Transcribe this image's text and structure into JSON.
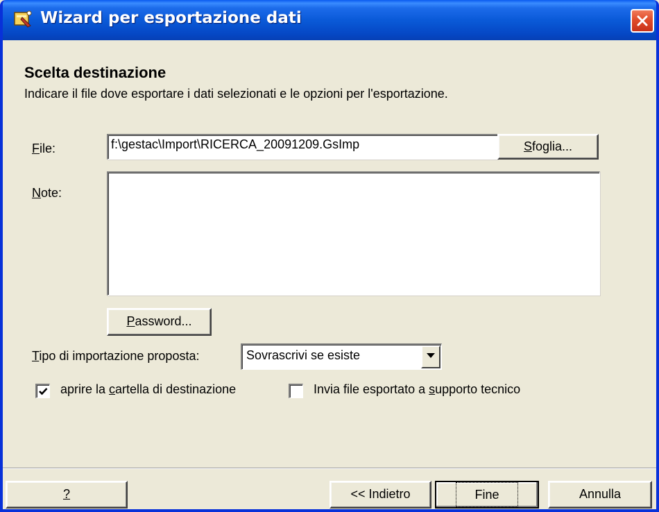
{
  "window": {
    "title": "Wizard per esportazione dati",
    "icon": "wizard-app-icon",
    "close_icon": "close-icon"
  },
  "page": {
    "heading": "Scelta destinazione",
    "description": "Indicare il file dove esportare i dati selezionati e le opzioni per l'esportazione."
  },
  "file": {
    "label_mnemonic": "F",
    "label_rest": "ile:",
    "value": "f:\\gestac\\Import\\RICERCA_20091209.GsImp",
    "browse_mnemonic": "S",
    "browse_rest": "foglia..."
  },
  "note": {
    "label_mnemonic": "N",
    "label_rest": "ote:",
    "value": ""
  },
  "password_button": {
    "mnemonic": "P",
    "rest": "assword..."
  },
  "import_type": {
    "label_mnemonic": "T",
    "label_rest": "ipo di importazione proposta:",
    "selected": "Sovrascrivi se esiste"
  },
  "checkboxes": {
    "open_folder": {
      "pre": "aprire la ",
      "mnemonic": "c",
      "post": "artella di destinazione",
      "checked": true
    },
    "send_support": {
      "pre": "Invia file esportato a ",
      "mnemonic": "s",
      "post": "upporto tecnico",
      "checked": false
    }
  },
  "footer": {
    "help_label": "?",
    "back_label": "<< Indietro",
    "finish_label": "Fine",
    "cancel_label": "Annulla"
  },
  "colors": {
    "titlebar": "#0a5ad8",
    "window_bg": "#ece9d8",
    "close_button": "#e04c2a"
  }
}
